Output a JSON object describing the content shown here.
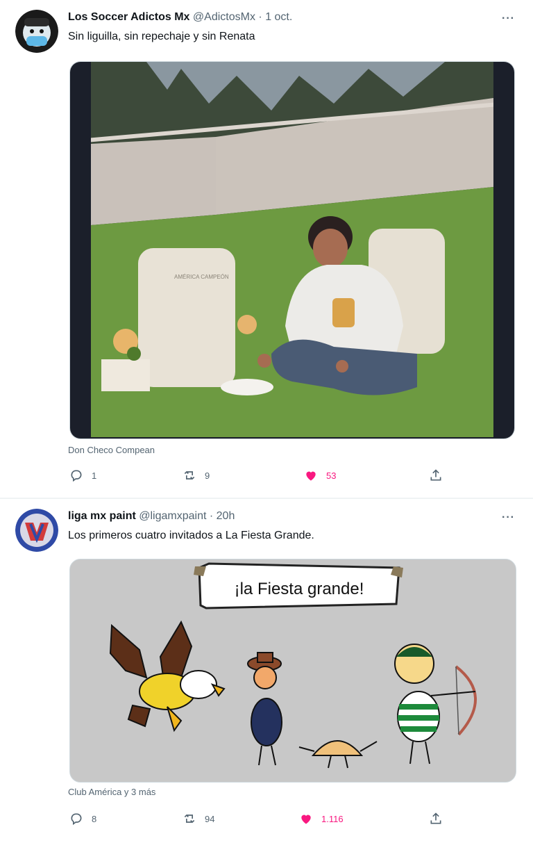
{
  "tweets": [
    {
      "author_name": "Los Soccer Adictos Mx",
      "handle": "@AdictosMx",
      "separator": "·",
      "time": "1 oct.",
      "text": "Sin liguilla, sin repechaje y sin Renata",
      "media_tag": "Don Checo Compean",
      "replies": "1",
      "retweets": "9",
      "likes": "53",
      "more": "···"
    },
    {
      "author_name": "liga mx paint",
      "handle": "@ligamxpaint",
      "separator": "·",
      "time": "20h",
      "text": "Los primeros cuatro invitados a La Fiesta Grande.",
      "media_tag": "Club América y 3 más",
      "replies": "8",
      "retweets": "94",
      "likes": "1.116",
      "more": "···",
      "banner_text": "¡la Fiesta grande!"
    }
  ],
  "colors": {
    "like": "#f91880",
    "secondary_text": "#536471",
    "border": "#cfd9de"
  },
  "icons": [
    "reply-icon",
    "retweet-icon",
    "like-icon",
    "share-icon",
    "more-icon"
  ]
}
